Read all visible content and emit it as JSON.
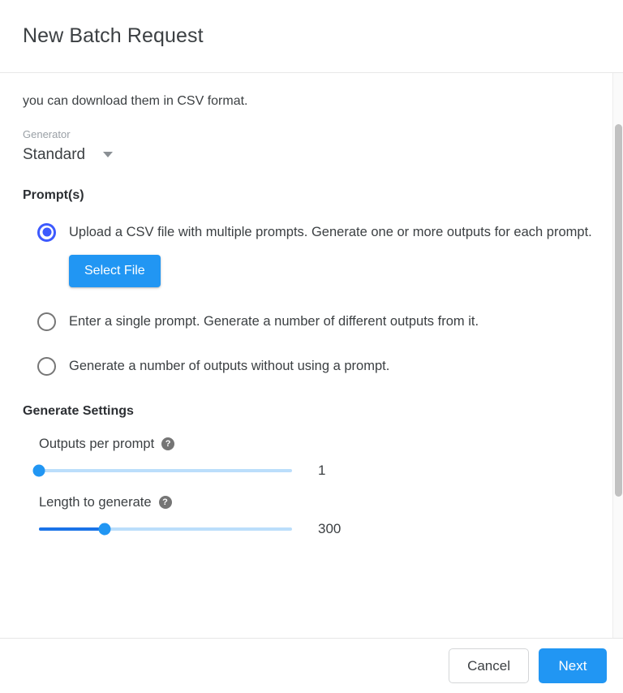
{
  "header": {
    "title": "New Batch Request"
  },
  "body": {
    "intro_text": "you can download them in CSV format.",
    "generator": {
      "label": "Generator",
      "value": "Standard",
      "caret_icon": "chevron-down-icon"
    },
    "prompts": {
      "heading": "Prompt(s)",
      "options": [
        {
          "label": "Upload a CSV file with multiple prompts. Generate one or more outputs for each prompt.",
          "selected": true,
          "button_label": "Select File"
        },
        {
          "label": "Enter a single prompt. Generate a number of different outputs from it.",
          "selected": false
        },
        {
          "label": "Generate a number of outputs without using a prompt.",
          "selected": false
        }
      ]
    },
    "generate_settings": {
      "heading": "Generate Settings",
      "sliders": [
        {
          "label": "Outputs per prompt",
          "help_icon": "help-circle-icon",
          "value": "1",
          "percent": 0
        },
        {
          "label": "Length to generate",
          "help_icon": "help-circle-icon",
          "value": "300",
          "percent": 26
        }
      ]
    }
  },
  "scrollbar": {
    "thumb_top_pct": 9,
    "thumb_height_pct": 66
  },
  "footer": {
    "cancel_label": "Cancel",
    "next_label": "Next"
  },
  "colors": {
    "primary_blue": "#2196f3",
    "radio_blue": "#3d5afe",
    "slider_fill": "#1a73e8",
    "slider_track": "#bbdefb"
  }
}
